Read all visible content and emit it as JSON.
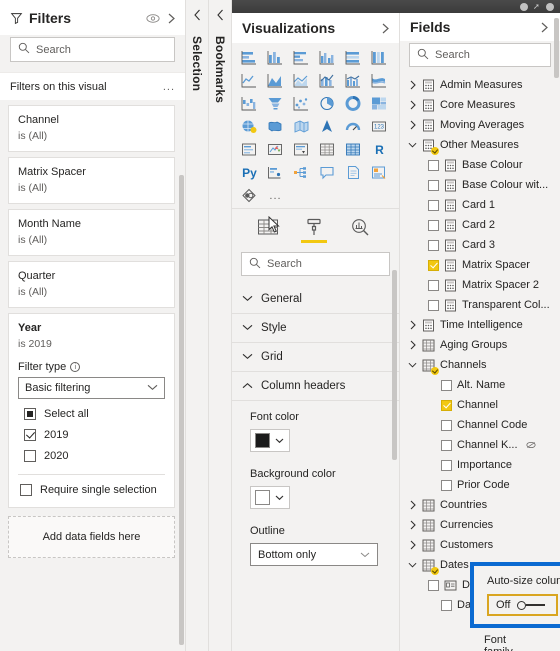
{
  "filters": {
    "title": "Filters",
    "eye_icon": "eye-icon",
    "collapse_icon": "chevron-right-icon",
    "search_placeholder": "Search",
    "section_label": "Filters on this visual",
    "more_label": "...",
    "cards": [
      {
        "name": "Channel",
        "value": "is (All)",
        "active": false
      },
      {
        "name": "Matrix Spacer",
        "value": "is (All)",
        "active": false
      },
      {
        "name": "Month Name",
        "value": "is (All)",
        "active": false
      },
      {
        "name": "Quarter",
        "value": "is (All)",
        "active": false
      }
    ],
    "year_card": {
      "name": "Year",
      "value": "is 2019",
      "filter_type_label": "Filter type",
      "filter_type_value": "Basic filtering",
      "options": [
        {
          "label": "Select all",
          "state": "partial"
        },
        {
          "label": "2019",
          "state": "checked"
        },
        {
          "label": "2020",
          "state": "unchecked"
        }
      ],
      "require_single": {
        "label": "Require single selection",
        "state": "unchecked"
      }
    },
    "dropzone_label": "Add data fields here"
  },
  "collapsed_panes": [
    {
      "label": "Selection",
      "chevron": "chevron-left-icon"
    },
    {
      "label": "Bookmarks",
      "chevron": "chevron-left-icon"
    }
  ],
  "visualizations": {
    "title": "Visualizations",
    "collapse_icon": "chevron-right-icon",
    "icons": [
      "stacked-bar-chart",
      "stacked-column-chart",
      "clustered-bar-chart",
      "clustered-column-chart",
      "100-stacked-bar-chart",
      "100-stacked-column-chart",
      "line-chart",
      "area-chart",
      "stacked-area-chart",
      "line-stacked-column-chart",
      "line-clustered-column-chart",
      "ribbon-chart",
      "waterfall-chart",
      "funnel-chart",
      "scatter-chart",
      "pie-chart",
      "donut-chart",
      "treemap",
      "map",
      "filled-map",
      "shape-map",
      "arcgis-map",
      "gauge-chart",
      "card",
      "multi-row-card",
      "kpi",
      "slicer",
      "table",
      "matrix",
      "r-script-visual",
      "python-script-visual",
      "key-influencers",
      "decomposition-tree",
      "qna",
      "smart-narrative",
      "paginated-report",
      "power-apps"
    ],
    "script_labels": {
      "r": "R",
      "py": "Py"
    },
    "more_visuals_label": "...",
    "tabs": [
      {
        "name": "fields-tab",
        "icon": "table-fields-icon",
        "active": false
      },
      {
        "name": "format-tab",
        "icon": "paint-roller-icon",
        "active": true
      },
      {
        "name": "analytics-tab",
        "icon": "magnifier-analytics-icon",
        "active": false
      }
    ],
    "search_placeholder": "Search",
    "sections": [
      {
        "label": "General",
        "expanded": false
      },
      {
        "label": "Style",
        "expanded": false
      },
      {
        "label": "Grid",
        "expanded": false
      },
      {
        "label": "Column headers",
        "expanded": true
      }
    ],
    "column_headers": {
      "font_color_label": "Font color",
      "font_color_value": "#1b1b1b",
      "background_color_label": "Background color",
      "background_color_value": "#ffffff",
      "outline_label": "Outline",
      "outline_value": "Bottom only",
      "autosize_label": "Auto-size column width",
      "autosize_state": "Off",
      "font_family_label": "Font family"
    },
    "highlight_color": "#0b6ad1",
    "focus_color": "#d9a520",
    "accent_color": "#f2c811"
  },
  "fields": {
    "title": "Fields",
    "collapse_icon": "chevron-right-icon",
    "search_placeholder": "Search",
    "tree": [
      {
        "label": "Admin Measures",
        "type": "group",
        "icon": "measure-table-icon",
        "expanded": false,
        "indent": 0
      },
      {
        "label": "Core Measures",
        "type": "group",
        "icon": "measure-table-icon",
        "expanded": false,
        "indent": 0
      },
      {
        "label": "Moving Averages",
        "type": "group",
        "icon": "measure-table-icon",
        "expanded": false,
        "indent": 0
      },
      {
        "label": "Other Measures",
        "type": "group",
        "icon": "measure-table-icon",
        "expanded": true,
        "badge": true,
        "indent": 0
      },
      {
        "label": "Base Colour",
        "type": "field",
        "icon": "measure-icon",
        "checked": false,
        "indent": 1
      },
      {
        "label": "Base Colour wit...",
        "type": "field",
        "icon": "measure-icon",
        "checked": false,
        "indent": 1
      },
      {
        "label": "Card 1",
        "type": "field",
        "icon": "measure-icon",
        "checked": false,
        "indent": 1
      },
      {
        "label": "Card 2",
        "type": "field",
        "icon": "measure-icon",
        "checked": false,
        "indent": 1
      },
      {
        "label": "Card 3",
        "type": "field",
        "icon": "measure-icon",
        "checked": false,
        "indent": 1
      },
      {
        "label": "Matrix Spacer",
        "type": "field",
        "icon": "measure-icon",
        "checked": true,
        "indent": 1
      },
      {
        "label": "Matrix Spacer 2",
        "type": "field",
        "icon": "measure-icon",
        "checked": false,
        "indent": 1
      },
      {
        "label": "Transparent Col...",
        "type": "field",
        "icon": "measure-icon",
        "checked": false,
        "indent": 1
      },
      {
        "label": "Time Intelligence",
        "type": "group",
        "icon": "measure-table-icon",
        "expanded": false,
        "indent": 0
      },
      {
        "label": "Aging Groups",
        "type": "group",
        "icon": "table-icon",
        "expanded": false,
        "indent": 0
      },
      {
        "label": "Channels",
        "type": "group",
        "icon": "table-icon",
        "expanded": true,
        "badge": true,
        "indent": 0
      },
      {
        "label": "Alt. Name",
        "type": "field",
        "icon": "none",
        "checked": false,
        "indent": 2
      },
      {
        "label": "Channel",
        "type": "field",
        "icon": "none",
        "checked": true,
        "indent": 2
      },
      {
        "label": "Channel Code",
        "type": "field",
        "icon": "none",
        "checked": false,
        "indent": 2
      },
      {
        "label": "Channel K...",
        "type": "field",
        "icon": "none",
        "checked": false,
        "hidden_eye": true,
        "indent": 2
      },
      {
        "label": "Importance",
        "type": "field",
        "icon": "none",
        "checked": false,
        "indent": 2
      },
      {
        "label": "Prior Code",
        "type": "field",
        "icon": "none",
        "checked": false,
        "indent": 2
      },
      {
        "label": "Countries",
        "type": "group",
        "icon": "table-icon",
        "expanded": false,
        "indent": 0
      },
      {
        "label": "Currencies",
        "type": "group",
        "icon": "table-icon",
        "expanded": false,
        "indent": 0
      },
      {
        "label": "Customers",
        "type": "group",
        "icon": "table-icon",
        "expanded": false,
        "indent": 0
      },
      {
        "label": "Dates",
        "type": "group",
        "icon": "table-icon",
        "expanded": true,
        "badge": true,
        "indent": 0
      },
      {
        "label": "Date",
        "type": "field",
        "icon": "date-icon",
        "checked": false,
        "indent": 1
      },
      {
        "label": "DateInt",
        "type": "field",
        "icon": "none",
        "checked": false,
        "indent": 2
      }
    ]
  }
}
